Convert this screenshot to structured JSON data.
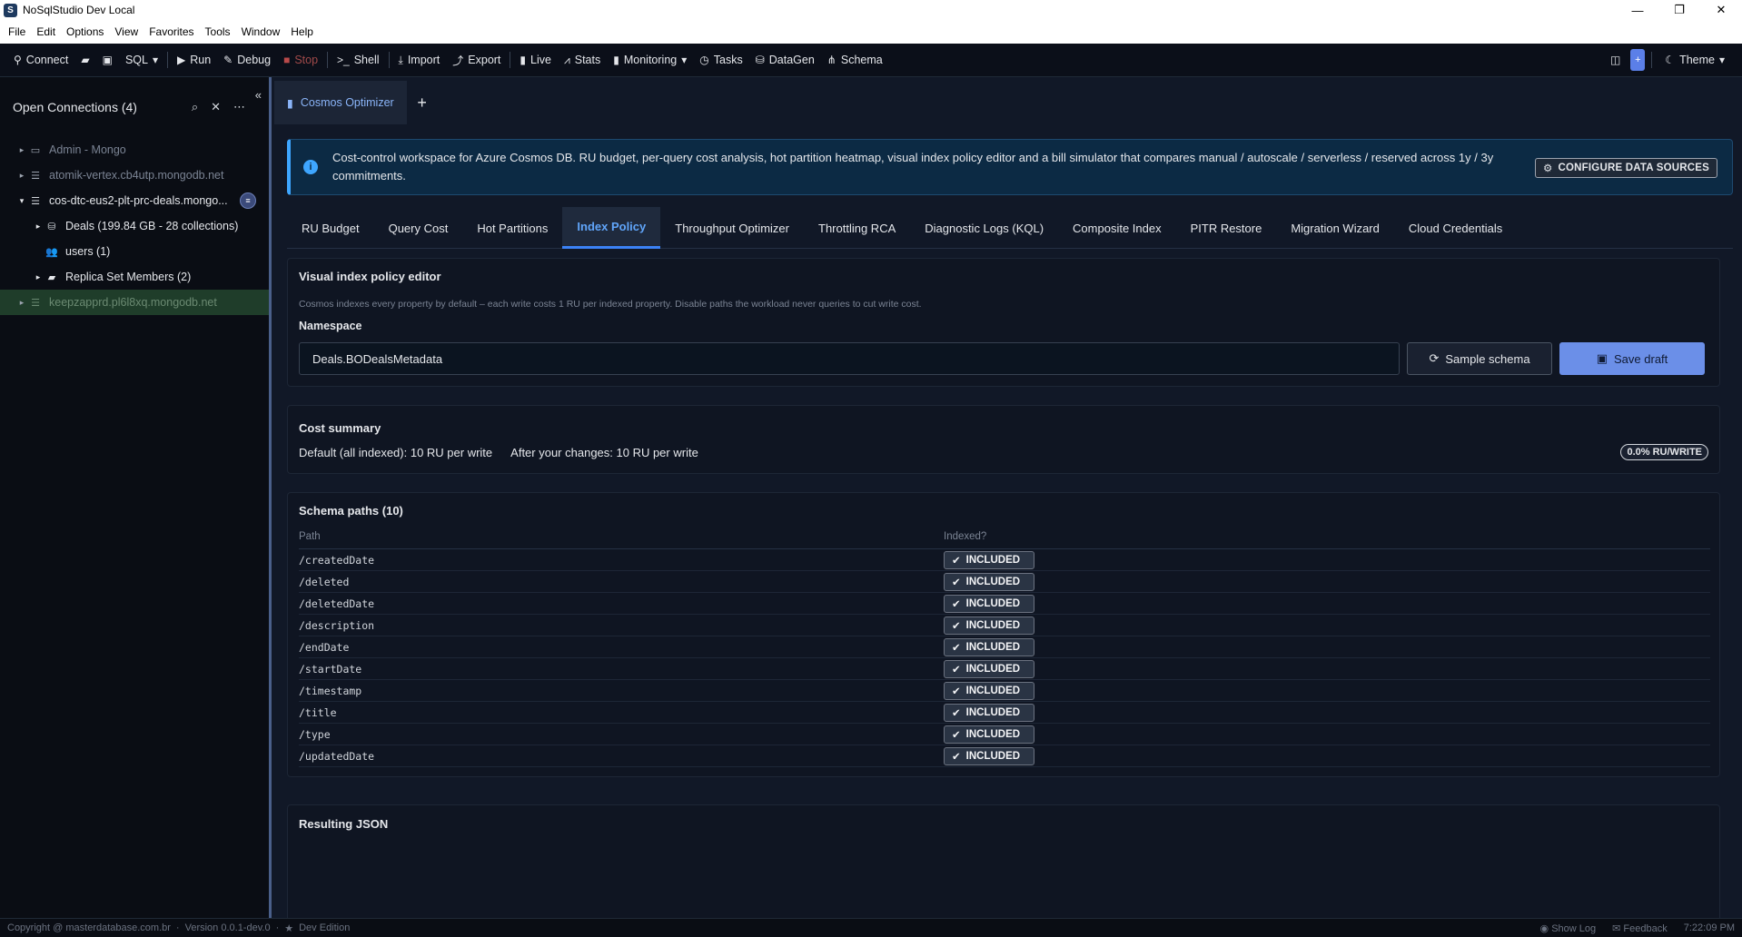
{
  "window": {
    "title": "NoSqlStudio Dev Local",
    "app_icon": "S",
    "controls": [
      "—",
      "❐",
      "✕"
    ]
  },
  "menu": [
    "File",
    "Edit",
    "Options",
    "View",
    "Favorites",
    "Tools",
    "Window",
    "Help"
  ],
  "toolbar": {
    "connect": "Connect",
    "sql": "SQL",
    "run": "Run",
    "debug": "Debug",
    "stop": "Stop",
    "shell": "Shell",
    "import": "Import",
    "export": "Export",
    "live": "Live",
    "stats": "Stats",
    "monitoring": "Monitoring",
    "tasks": "Tasks",
    "datagen": "DataGen",
    "schema": "Schema",
    "theme": "Theme",
    "plus": "+"
  },
  "sidebar": {
    "title": "Open Connections (4)",
    "items": [
      {
        "label": "Admin - Mongo"
      },
      {
        "label": "atomik-vertex.cb4utp.mongodb.net"
      },
      {
        "label": "cos-dtc-eus2-plt-prc-deals.mongo..."
      },
      {
        "label": "Deals (199.84 GB - 28 collections)"
      },
      {
        "label": "users (1)"
      },
      {
        "label": "Replica Set Members (2)"
      },
      {
        "label": "keepzapprd.pl6l8xq.mongodb.net"
      }
    ]
  },
  "doc_tab": {
    "label": "Cosmos Optimizer",
    "add": "+"
  },
  "banner": {
    "text": "Cost-control workspace for Azure Cosmos DB. RU budget, per-query cost analysis, hot partition heatmap, visual index policy editor and a bill simulator that compares manual / autoscale / serverless / reserved across 1y / 3y commitments.",
    "button": "CONFIGURE DATA SOURCES"
  },
  "subtabs": [
    "RU Budget",
    "Query Cost",
    "Hot Partitions",
    "Index Policy",
    "Throughput Optimizer",
    "Throttling RCA",
    "Diagnostic Logs (KQL)",
    "Composite Index",
    "PITR Restore",
    "Migration Wizard",
    "Cloud Credentials"
  ],
  "editor": {
    "title": "Visual index policy editor",
    "description": "Cosmos indexes every property by default – each write costs 1 RU per indexed property. Disable paths the workload never queries to cut write cost.",
    "namespace_label": "Namespace",
    "namespace_value": "Deals.BODealsMetadata",
    "sample_button": "Sample schema",
    "save_button": "Save draft"
  },
  "cost": {
    "title": "Cost summary",
    "default_text": "Default (all indexed): 10 RU per write",
    "after_text": "After your changes: 10 RU per write",
    "rate_badge": "0.0% RU/WRITE"
  },
  "schema": {
    "title": "Schema paths (10)",
    "col_path": "Path",
    "col_indexed": "Indexed?",
    "rows": [
      {
        "path": "/createdDate",
        "status": "INCLUDED"
      },
      {
        "path": "/deleted",
        "status": "INCLUDED"
      },
      {
        "path": "/deletedDate",
        "status": "INCLUDED"
      },
      {
        "path": "/description",
        "status": "INCLUDED"
      },
      {
        "path": "/endDate",
        "status": "INCLUDED"
      },
      {
        "path": "/startDate",
        "status": "INCLUDED"
      },
      {
        "path": "/timestamp",
        "status": "INCLUDED"
      },
      {
        "path": "/title",
        "status": "INCLUDED"
      },
      {
        "path": "/type",
        "status": "INCLUDED"
      },
      {
        "path": "/updatedDate",
        "status": "INCLUDED"
      }
    ]
  },
  "json_section": {
    "title": "Resulting JSON"
  },
  "status": {
    "copyright": "Copyright @ masterdatabase.com.br",
    "version": "Version 0.0.1-dev.0",
    "edition": "Dev Edition",
    "show_log": "Show Log",
    "feedback": "Feedback",
    "time": "7:22:09 PM"
  },
  "colors": {
    "accent": "#3b82f6",
    "save_button": "#6b8fe8",
    "banner_bg": "#0c2a44",
    "selected_connection": "#1f3d2a"
  }
}
